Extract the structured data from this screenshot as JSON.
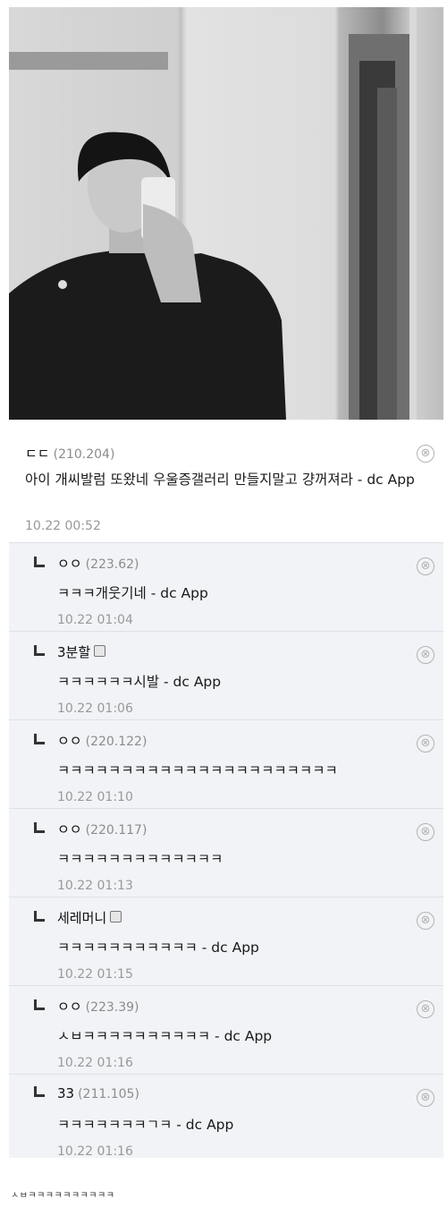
{
  "top_comment": {
    "nick": "ㄷㄷ",
    "ip": "(210.204)",
    "text": "아이 개씨발럼 또왔네 우울증갤러리 만들지말고 걍꺼져라 - dc App",
    "time": "10.22 00:52"
  },
  "replies": [
    {
      "nick": "ㅇㅇ",
      "ip": "(223.62)",
      "badge": false,
      "text": "ㅋㅋㅋ개웃기네 - dc App",
      "time": "10.22 01:04"
    },
    {
      "nick": "3분할",
      "ip": "",
      "badge": true,
      "text": "ㅋㅋㅋㅋㅋㅋ시발 - dc App",
      "time": "10.22 01:06"
    },
    {
      "nick": "ㅇㅇ",
      "ip": "(220.122)",
      "badge": false,
      "text": "ㅋㅋㅋㅋㅋㅋㅋㅋㅋㅋㅋㅋㅋㅋㅋㅋㅋㅋㅋㅋㅋㅋ",
      "time": "10.22 01:10"
    },
    {
      "nick": "ㅇㅇ",
      "ip": "(220.117)",
      "badge": false,
      "text": "ㅋㅋㅋㅋㅋㅋㅋㅋㅋㅋㅋㅋㅋ",
      "time": "10.22 01:13"
    },
    {
      "nick": "세레머니",
      "ip": "",
      "badge": true,
      "text": "ㅋㅋㅋㅋㅋㅋㅋㅋㅋㅋㅋ - dc App",
      "time": "10.22 01:15"
    },
    {
      "nick": "ㅇㅇ",
      "ip": "(223.39)",
      "badge": false,
      "text": "ㅅㅂㅋㅋㅋㅋㅋㅋㅋㅋㅋㅋ - dc App",
      "time": "10.22 01:16"
    },
    {
      "nick": "33",
      "ip": "(211.105)",
      "badge": false,
      "text": "ㅋㅋㅋㅋㅋㅋㅋㄱㅋ - dc App",
      "time": "10.22 01:16"
    }
  ],
  "delete_glyph": "⊗",
  "footer_text": "ㅅㅂㅋㅋㅋㅋㅋㅋㅋㅋㅋㅋ",
  "colors": {
    "reply_bg": "#f1f3f6",
    "meta_gray": "#999999"
  }
}
